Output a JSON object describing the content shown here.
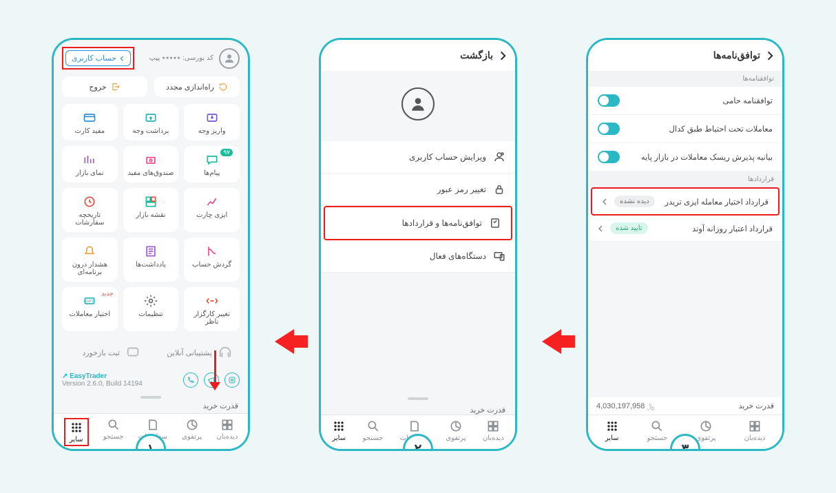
{
  "steps": {
    "one": "۱",
    "two": "۲",
    "three": "۳"
  },
  "phone1": {
    "code_label": "کد بورسی:",
    "code_value": "٭٭٭٭٭",
    "code_suffix": "پپپ",
    "account_btn": "حساب کاربری",
    "restart": "راه‌اندازی مجدد",
    "logout": "خروج",
    "tiles": {
      "deposit": "واریز وجه",
      "withdraw": "برداشت وجه",
      "card": "مفید کارت",
      "messages": "پیام‌ها",
      "fund": "صندوق‌های مفید",
      "market": "نمای بازار",
      "chart": "ایزی چارت",
      "map": "نقشه بازار",
      "history": "تاریخچه سفارشات",
      "turnover": "گردش حساب",
      "notes": "یادداشت‌ها",
      "alert": "هشدار درون برنامه‌ای",
      "broker": "تغییر کارگزار ناظر",
      "settings": "تنظیمات",
      "options": "اختیار معاملات",
      "options_new": "جدید",
      "msg_badge": "۹۷"
    },
    "support": "پشتیبانی آنلاین",
    "feedback": "ثبت بازخورد",
    "app_name": "EasyTrader",
    "version": "Version 2.6.0, Build 14194",
    "buy_power": "قدرت خرید",
    "nav": {
      "watch": "دیده‌بان",
      "portfolio": "پرتفوی",
      "orders": "سفارشات",
      "search": "جستجو",
      "more": "سایر"
    }
  },
  "phone2": {
    "back": "بازگشت",
    "edit": "ویرایش حساب کاربری",
    "password": "تغییر رمز عبور",
    "agreements": "توافق‌نامه‌ها و قراردادها",
    "devices": "دستگاه‌های فعال",
    "buy_power": "قدرت خرید",
    "nav": {
      "watch": "دیده‌بان",
      "portfolio": "پرتفوی",
      "orders": "سفارشات",
      "search": "جستجو",
      "more": "سایر"
    }
  },
  "phone3": {
    "title": "توافق‌نامه‌ها",
    "section_agreements": "توافقنامه‌ها",
    "row1": "توافقنامه حامی",
    "row2": "معاملات تحت احتیاط طبق کدال",
    "row3": "بیانیه پذیرش ریسک معاملات در بازار پایه",
    "section_contracts": "قراردادها",
    "contract1": "قرارداد اختیار معامله ایزی تریدر",
    "contract1_status": "دیده نشده",
    "contract2": "قرارداد اعتبار روزانه آوند",
    "contract2_status": "تایید شده",
    "buy_power": "قدرت خرید",
    "amount": "4,030,197,958",
    "nav": {
      "watch": "دیده‌بان",
      "portfolio": "پرتفوی",
      "search": "جستجو",
      "more": "سایر"
    }
  }
}
